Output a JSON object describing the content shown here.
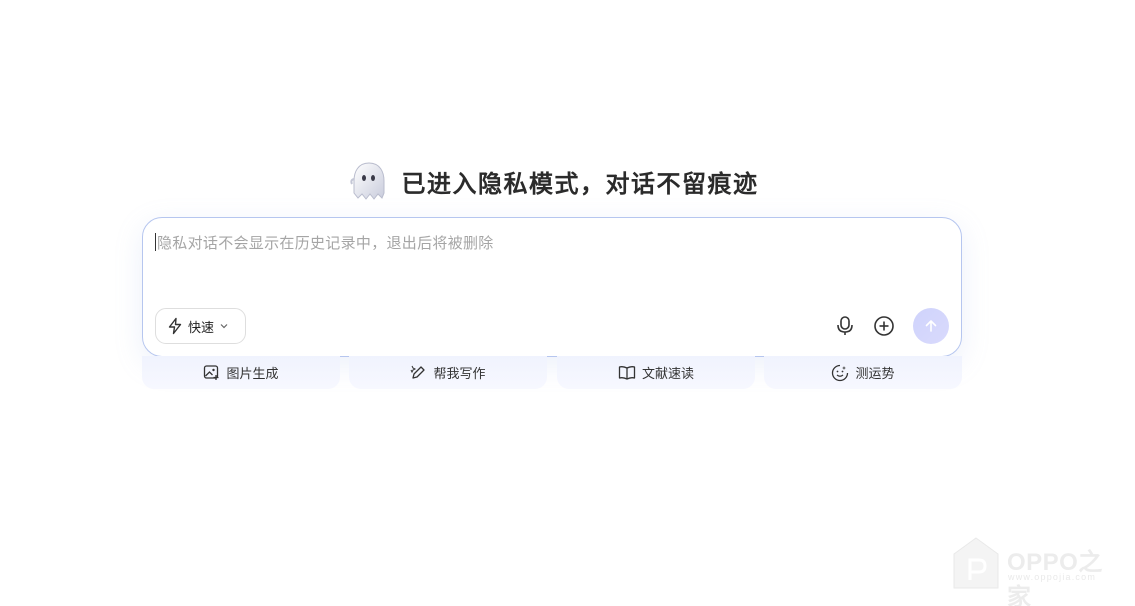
{
  "heading": {
    "icon": "ghost-icon",
    "text": "已进入隐私模式，对话不留痕迹"
  },
  "composer": {
    "placeholder": "隐私对话不会显示在历史记录中，退出后将被删除",
    "mode": {
      "icon": "lightning-icon",
      "label": "快速",
      "dropdown_icon": "chevron-down-icon"
    },
    "mic_icon": "microphone-icon",
    "add_icon": "plus-circle-icon",
    "send_icon": "arrow-up-icon"
  },
  "quick_actions": [
    {
      "label": "图片生成",
      "icon": "image-plus-icon"
    },
    {
      "label": "帮我写作",
      "icon": "pen-sparkle-icon"
    },
    {
      "label": "文献速读",
      "icon": "book-open-icon"
    },
    {
      "label": "测运势",
      "icon": "fortune-dial-icon"
    }
  ],
  "watermark": {
    "brand": "OPPO之家",
    "url": "www.oppojia.com"
  },
  "colors": {
    "card_border": "#b6c6ef",
    "send_button": "#cfd3fb",
    "chip_bg": "#f0f3fe"
  }
}
